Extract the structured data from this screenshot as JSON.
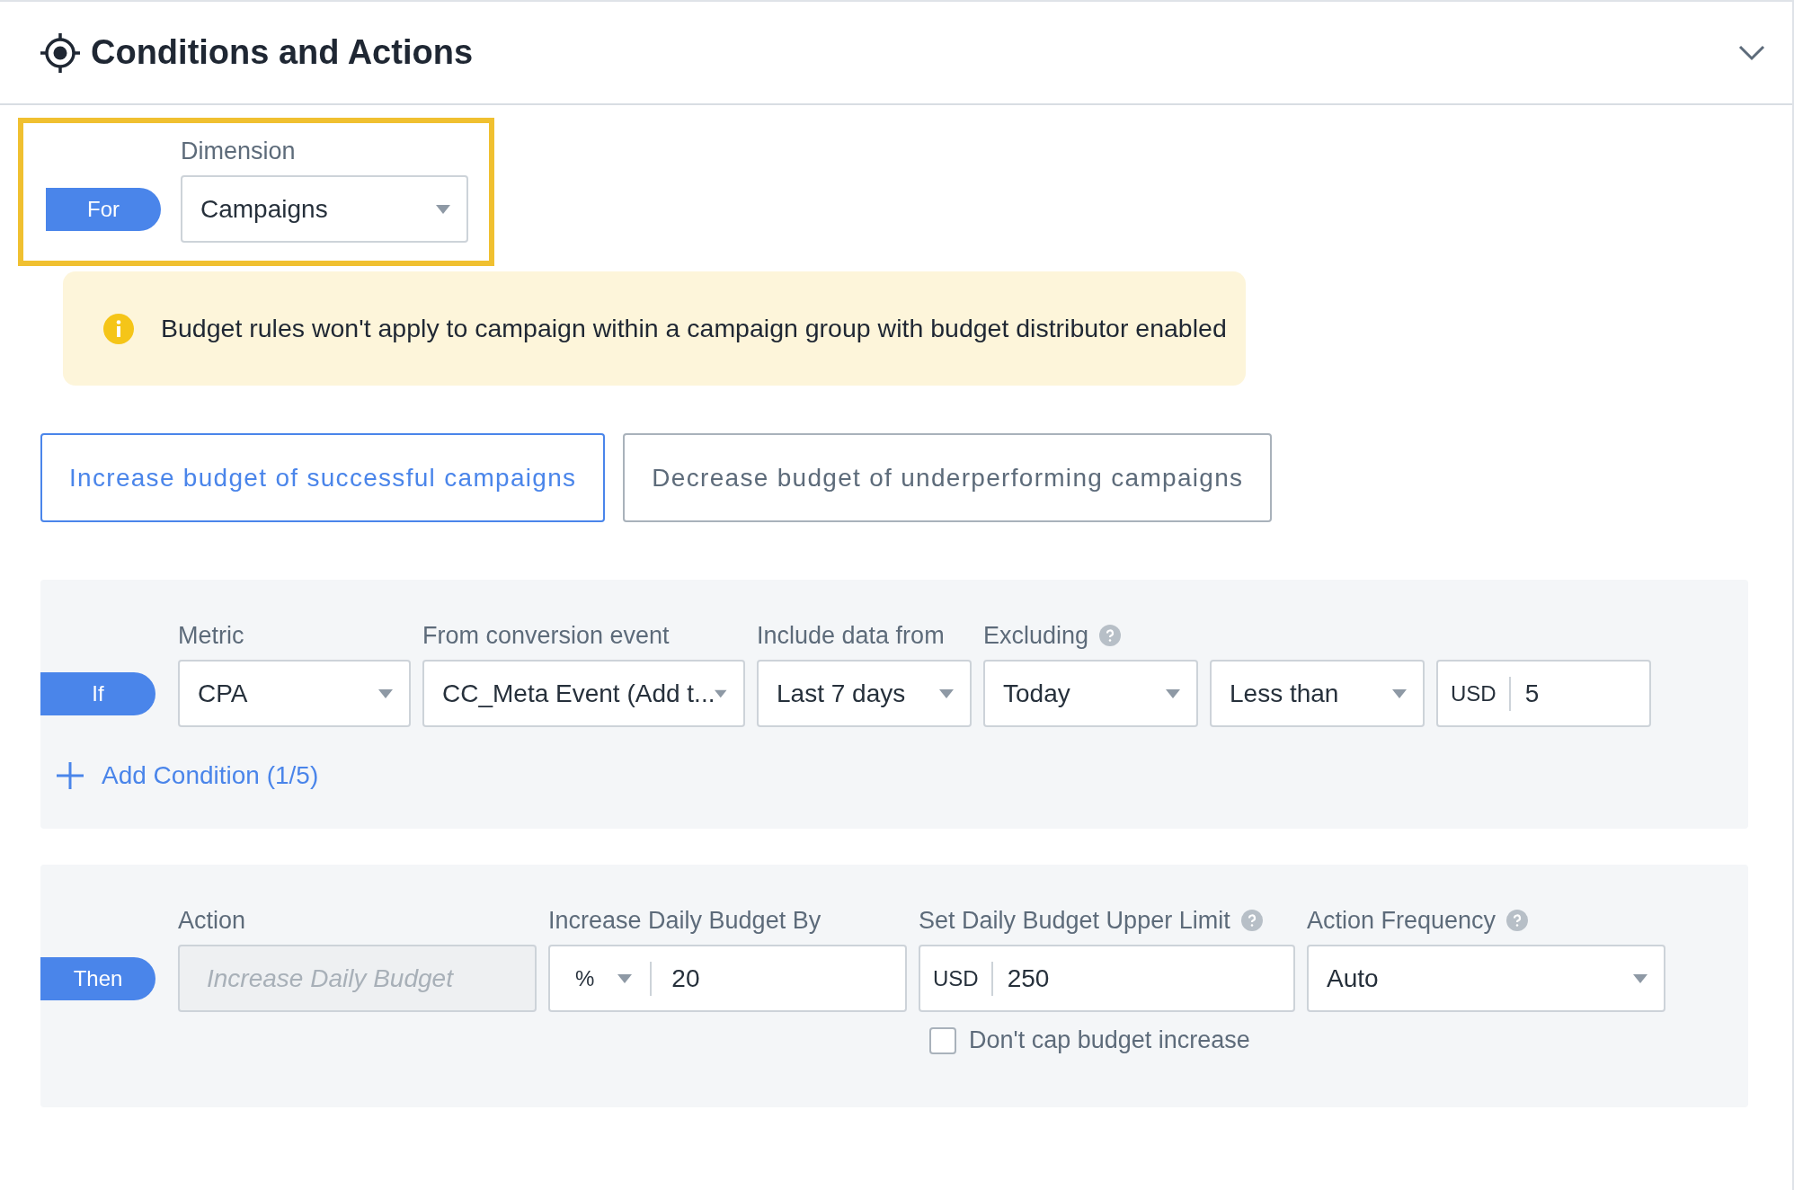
{
  "header": {
    "title": "Conditions and Actions",
    "expanded": true
  },
  "dimension": {
    "highlighted": true,
    "pill": "For",
    "label": "Dimension",
    "value": "Campaigns"
  },
  "notice": {
    "text": "Budget rules won't apply to campaign within a campaign group with budget distributor enabled"
  },
  "modes": [
    {
      "label": "Increase budget of successful campaigns",
      "selected": true
    },
    {
      "label": "Decrease budget of underperforming campaigns",
      "selected": false
    }
  ],
  "conditions": {
    "pill": "If",
    "fields": [
      {
        "kind": "select",
        "label": "Metric",
        "value": "CPA"
      },
      {
        "kind": "select",
        "label": "From conversion event",
        "value": "CC_Meta Event (Add t..."
      },
      {
        "kind": "select",
        "label": "Include data from",
        "value": "Last 7 days"
      },
      {
        "kind": "select",
        "label": "Excluding",
        "value": "Today",
        "help": true
      },
      {
        "kind": "select",
        "value": "Less than"
      },
      {
        "kind": "currency",
        "prefix": "USD",
        "value": "5"
      }
    ],
    "add_condition": "Add Condition (1/5)"
  },
  "actions": {
    "pill": "Then",
    "fields": [
      {
        "kind": "disabled",
        "label": "Action",
        "placeholder": "Increase Daily Budget"
      },
      {
        "kind": "unit",
        "label": "Increase Daily Budget By",
        "unit": "%",
        "value": "20"
      },
      {
        "kind": "currency",
        "label": "Set Daily Budget Upper Limit",
        "prefix": "USD",
        "value": "250",
        "help": true
      },
      {
        "kind": "select",
        "label": "Action Frequency",
        "value": "Auto",
        "help": true
      }
    ],
    "checkbox": {
      "label": "Don't cap budget increase",
      "checked": false
    }
  }
}
